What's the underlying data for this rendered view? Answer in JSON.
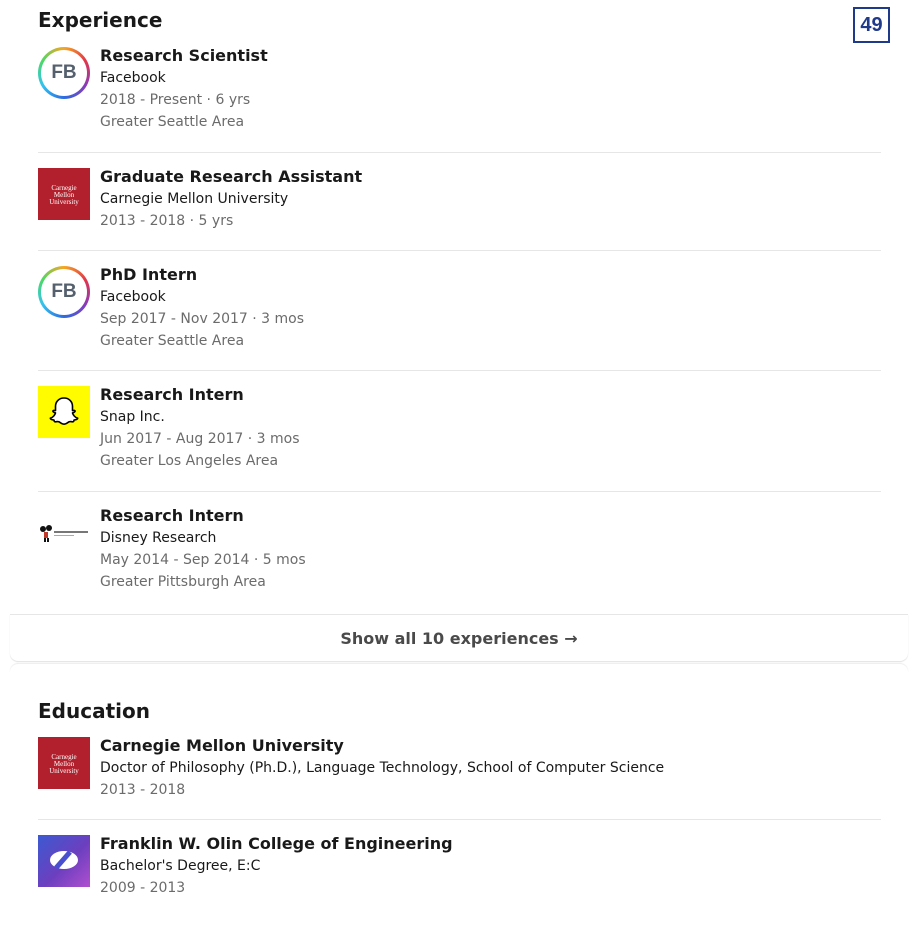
{
  "badge": "49",
  "experience": {
    "title": "Experience",
    "items": [
      {
        "logo": "FB",
        "title": "Research Scientist",
        "company": "Facebook",
        "dates": "2018 - Present · 6 yrs",
        "location": "Greater Seattle Area"
      },
      {
        "logo": "Carnegie Mellon University",
        "title": "Graduate Research Assistant",
        "company": "Carnegie Mellon University",
        "dates": "2013 - 2018 · 5 yrs"
      },
      {
        "logo": "FB",
        "title": "PhD Intern",
        "company": "Facebook",
        "dates": "Sep 2017 - Nov 2017 · 3 mos",
        "location": "Greater Seattle Area"
      },
      {
        "logo": "snapchat-ghost-icon",
        "title": "Research Intern",
        "company": "Snap Inc.",
        "dates": "Jun 2017 - Aug 2017 · 3 mos",
        "location": "Greater Los Angeles Area"
      },
      {
        "logo": "disney-research-logo",
        "title": "Research Intern",
        "company": "Disney Research",
        "dates": "May 2014 - Sep 2014 · 5 mos",
        "location": "Greater Pittsburgh Area"
      }
    ],
    "show_all": "Show all 10 experiences →"
  },
  "education": {
    "title": "Education",
    "items": [
      {
        "logo": "Carnegie Mellon University",
        "school": "Carnegie Mellon University",
        "degree": "Doctor of Philosophy (Ph.D.), Language Technology, School of Computer Science",
        "dates": "2013 - 2018"
      },
      {
        "logo": "olin-logo",
        "school": "Franklin W. Olin College of Engineering",
        "degree": "Bachelor's Degree, E:C",
        "dates": "2009 - 2013"
      }
    ]
  }
}
